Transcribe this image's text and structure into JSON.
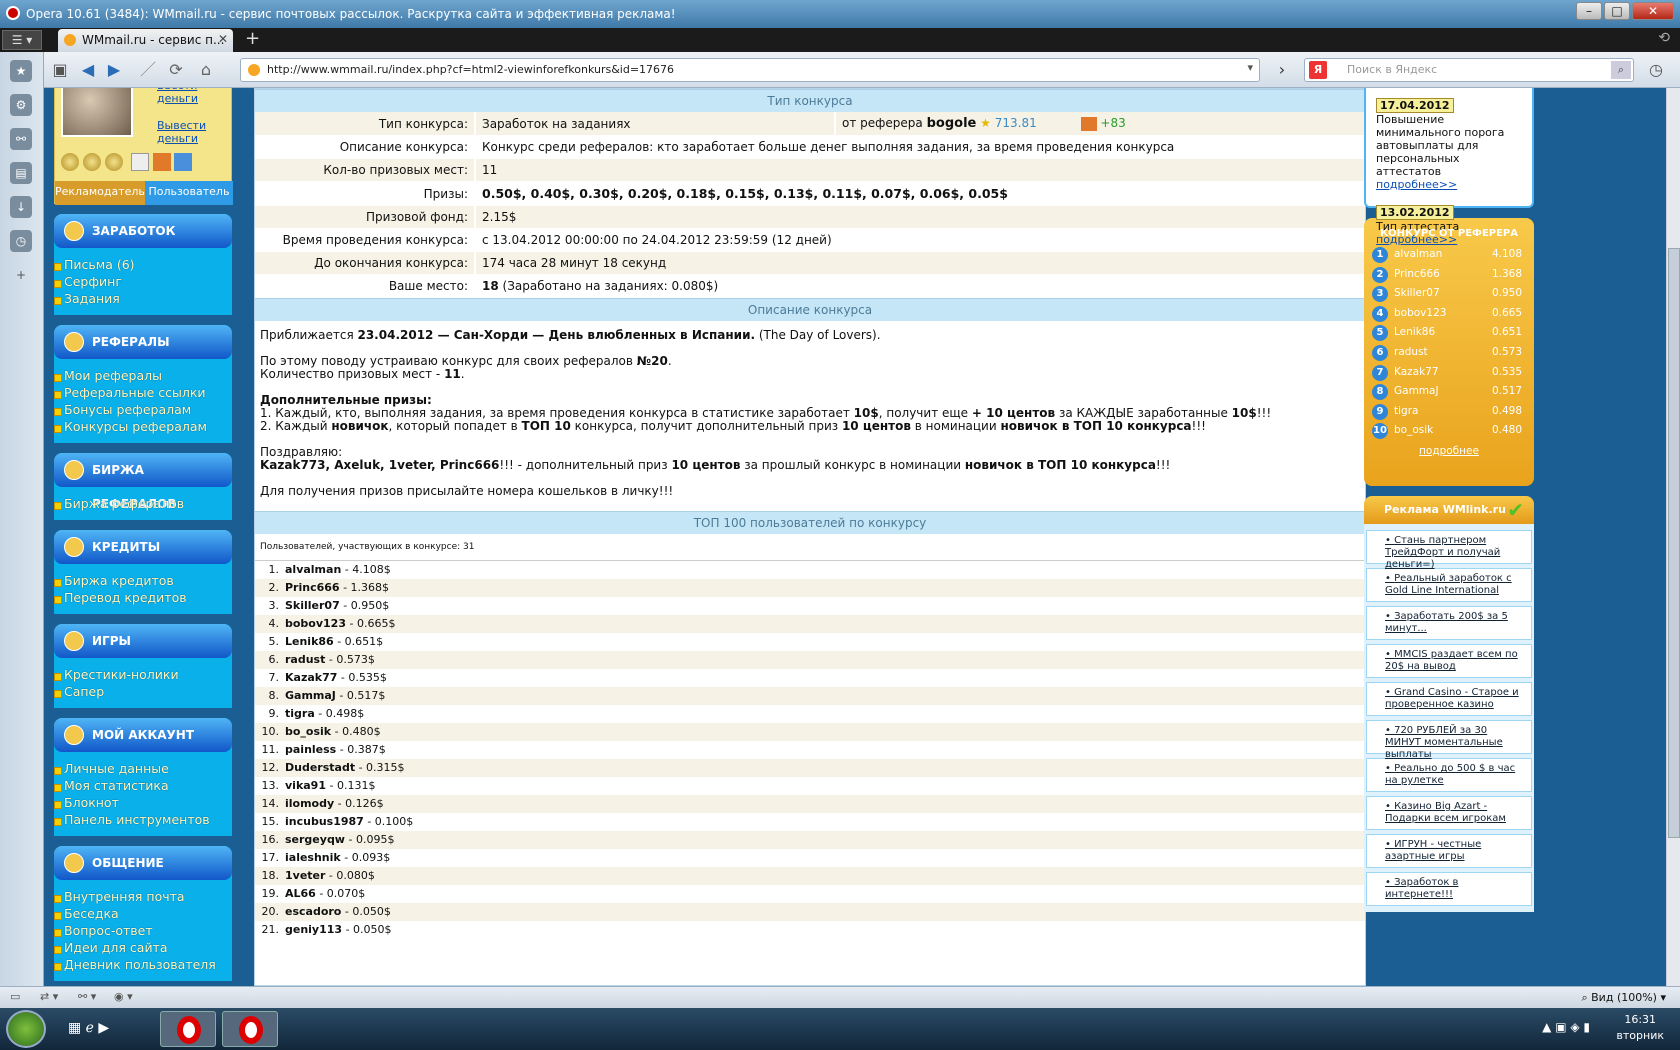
{
  "window": {
    "title": "Opera 10.61 (3484): WMmail.ru - сервис почтовых рассылок. Раскрутка сайта и эффективная реклама!"
  },
  "tab": {
    "label": "WMmail.ru - сервис п..."
  },
  "address": {
    "url": "http://www.wmmail.ru/index.php?cf=html2-viewinforefkonkurs&id=17676",
    "search_placeholder": "Поиск в Яндекс"
  },
  "profile": {
    "deposit": "Ввести деньги",
    "withdraw": "Вывести деньги",
    "tab_adv": "Рекламодатель",
    "tab_user": "Пользователь"
  },
  "menu": [
    {
      "title": "ЗАРАБОТОК",
      "items": [
        "Письма (6)",
        "Серфинг",
        "Задания"
      ]
    },
    {
      "title": "РЕФЕРАЛЫ",
      "items": [
        "Мои рефералы",
        "Реферальные ссылки",
        "Бонусы рефералам",
        "Конкурсы рефералам"
      ]
    },
    {
      "title": "БИРЖА РЕФЕРАЛОВ",
      "items": [
        "Биржа рефералов"
      ]
    },
    {
      "title": "КРЕДИТЫ",
      "items": [
        "Биржа кредитов",
        "Перевод кредитов"
      ]
    },
    {
      "title": "ИГРЫ",
      "items": [
        "Крестики-нолики",
        "Сапер"
      ]
    },
    {
      "title": "МОЙ АККАУНТ",
      "items": [
        "Личные данные",
        "Моя статистика",
        "Блокнот",
        "Панель инструментов"
      ]
    },
    {
      "title": "ОБЩЕНИЕ",
      "items": [
        "Внутренняя почта",
        "Беседка",
        "Вопрос-ответ",
        "Идеи для сайта",
        "Дневник пользователя"
      ]
    }
  ],
  "contest": {
    "header": "Тип конкурса",
    "rows": [
      {
        "label": "Тип конкурса:",
        "value": "Заработок на заданиях"
      },
      {
        "label": "Описание конкурса:",
        "value": "Конкурс среди рефералов: кто заработает больше денег выполняя задания, за время проведения конкурса"
      },
      {
        "label": "Кол-во призовых мест:",
        "value": "11"
      },
      {
        "label": "Призы:",
        "value": "0.50$, 0.40$, 0.30$, 0.20$, 0.18$, 0.15$, 0.13$, 0.11$, 0.07$, 0.06$, 0.05$"
      },
      {
        "label": "Призовой фонд:",
        "value": "2.15$"
      },
      {
        "label": "Время проведения конкурса:",
        "value": "с 13.04.2012 00:00:00 по 24.04.2012 23:59:59 (12 дней)"
      },
      {
        "label": "До окончания конкурса:",
        "value": "174 часа 28 минут 18 секунд"
      },
      {
        "label": "Ваше место:",
        "value_bold": "18",
        "value": " (Заработано на заданиях: 0.080$)"
      }
    ],
    "referrer_prefix": "от реферера",
    "referrer": "bogole",
    "ref_rating": "713.81",
    "ref_bonus": "+83",
    "desc_header": "Описание конкурса",
    "desc": {
      "l1a": "Приближается ",
      "l1b": "23.04.2012 — Сан-Хорди — День влюбленных в Испании.",
      "l1c": " (The Day of Lovers).",
      "l2a": "По этому поводу устраиваю конкурс для своих рефералов ",
      "l2b": "№20",
      ".": ".",
      "l3a": "Количество призовых мест - ",
      "l3b": "11",
      "l4": "Дополнительные призы:",
      "l5a": "1. Каждый, кто, выполняя задания, за время проведения конкурса в статистике заработает ",
      "l5b": "10$",
      "l5c": ", получит еще ",
      "l5d": "+ 10 центов",
      "l5e": " за КАЖДЫЕ заработанные ",
      "l5f": "10$",
      "l5g": "!!!",
      "l6a": "2. Каждый ",
      "l6b": "новичок",
      "l6c": ", который попадет в ",
      "l6d": "ТОП 10",
      "l6e": " конкурса, получит дополнительный приз ",
      "l6f": "10 центов",
      "l6g": " в номинации ",
      "l6h": "новичок в ТОП 10 конкурса",
      "l6i": "!!!",
      "l7": "Поздравляю:",
      "l8a": "Kazak773, Axeluk, 1veter, Princ666",
      "l8b": "!!! - дополнительный приз ",
      "l8c": "10 центов",
      "l8d": " за прошлый конкурс в номинации ",
      "l8e": "новичок в ТОП 10 конкурса",
      "l8f": "!!!",
      "l9": "Для получения призов присылайте номера кошельков в личку!!!"
    },
    "top_header": "ТОП 100 пользователей по конкурсу",
    "participants": "Пользователей, участвующих в конкурсе: 31"
  },
  "ranking": [
    {
      "n": "1.",
      "name": "alvalman",
      "val": " - 4.108$"
    },
    {
      "n": "2.",
      "name": "Princ666",
      "val": " - 1.368$"
    },
    {
      "n": "3.",
      "name": "Skiller07",
      "val": " - 0.950$"
    },
    {
      "n": "4.",
      "name": "bobov123",
      "val": " - 0.665$"
    },
    {
      "n": "5.",
      "name": "Lenik86",
      "val": " - 0.651$"
    },
    {
      "n": "6.",
      "name": "radust",
      "val": " - 0.573$"
    },
    {
      "n": "7.",
      "name": "Kazak77",
      "val": " - 0.535$"
    },
    {
      "n": "8.",
      "name": "GammaJ",
      "val": " - 0.517$"
    },
    {
      "n": "9.",
      "name": "tigra",
      "val": " - 0.498$"
    },
    {
      "n": "10.",
      "name": "bo_osik",
      "val": " - 0.480$"
    },
    {
      "n": "11.",
      "name": "painless",
      "val": " - 0.387$"
    },
    {
      "n": "12.",
      "name": "Duderstadt",
      "val": " - 0.315$"
    },
    {
      "n": "13.",
      "name": "vika91",
      "val": " - 0.131$"
    },
    {
      "n": "14.",
      "name": "ilomody",
      "val": " - 0.126$"
    },
    {
      "n": "15.",
      "name": "incubus1987",
      "val": " - 0.100$"
    },
    {
      "n": "16.",
      "name": "sergeyqw",
      "val": " - 0.095$"
    },
    {
      "n": "17.",
      "name": "ialeshnik",
      "val": " - 0.093$"
    },
    {
      "n": "18.",
      "name": "1veter",
      "val": " - 0.080$"
    },
    {
      "n": "19.",
      "name": "AL66",
      "val": " - 0.070$"
    },
    {
      "n": "20.",
      "name": "escadoro",
      "val": " - 0.050$"
    },
    {
      "n": "21.",
      "name": "geniy113",
      "val": " - 0.050$"
    }
  ],
  "news": [
    {
      "date": "17.04.2012",
      "text": "Повышение минимального порога автовыплаты для персональных аттестатов",
      "more": "подробнее>>"
    },
    {
      "date": "13.02.2012",
      "text": "Тип аттестата",
      "more": "подробнее>>"
    }
  ],
  "ref_konkurs": {
    "title": "КОНКУРС ОТ РЕФЕРЕРА",
    "more": "подробнее",
    "rows": [
      {
        "n": "1",
        "name": "alvalman",
        "v": "4.108"
      },
      {
        "n": "2",
        "name": "Princ666",
        "v": "1.368"
      },
      {
        "n": "3",
        "name": "Skiller07",
        "v": "0.950"
      },
      {
        "n": "4",
        "name": "bobov123",
        "v": "0.665"
      },
      {
        "n": "5",
        "name": "Lenik86",
        "v": "0.651"
      },
      {
        "n": "6",
        "name": "radust",
        "v": "0.573"
      },
      {
        "n": "7",
        "name": "Kazak77",
        "v": "0.535"
      },
      {
        "n": "8",
        "name": "GammaJ",
        "v": "0.517"
      },
      {
        "n": "9",
        "name": "tigra",
        "v": "0.498"
      },
      {
        "n": "10",
        "name": "bo_osik",
        "v": "0.480"
      }
    ]
  },
  "ads": {
    "title": "Реклама WMlink.ru",
    "items": [
      "Стань партнером ТрейдФорт и получай деньги=)",
      "Реальный заработок с Gold Line International",
      "Заработать 200$ за 5 минут...",
      "MMCIS раздает всем по 20$ на вывод",
      "Grand Casino - Старое и проверенное казино",
      "720 РУБЛЕЙ за 30 МИНУТ моментальные выплаты",
      "Реально до 500 $ в час на рулетке",
      "Казино Big Azart - Подарки всем игрокам",
      "ИГРУН - честные азартные игры",
      "Заработок в интернете!!!"
    ]
  },
  "status": {
    "zoom": "Вид (100%)"
  },
  "taskbar": {
    "time": "16:31",
    "day": "вторник"
  }
}
